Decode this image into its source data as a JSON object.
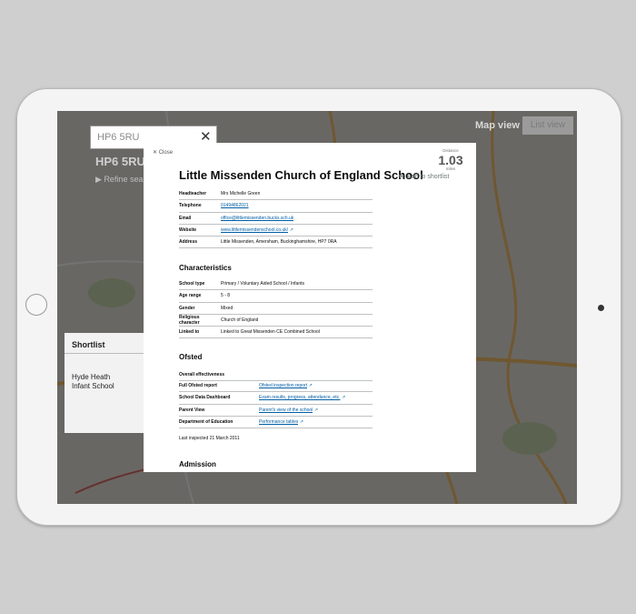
{
  "map": {
    "search_value": "HP6 5RU",
    "postcode_heading": "HP6 5RU",
    "refine_label": "Refine search",
    "map_view_label": "Map view",
    "list_view_label": "List view",
    "shortlist_title": "Shortlist",
    "shortlist_item": "Hyde Heath Infant School"
  },
  "modal": {
    "close_label": "Close",
    "distance_label": "Distance",
    "distance_value": "1.03",
    "distance_unit": "miles",
    "school_name": "Little Missenden Church of England School",
    "add_shortlist_label": "Add to shortlist",
    "contact": [
      {
        "key": "Headteacher",
        "value": "Mrs Michelle Green",
        "link": false
      },
      {
        "key": "Telephone",
        "value": "01494862021",
        "link": true
      },
      {
        "key": "Email",
        "value": "office@littlemissenden.bucks.sch.uk",
        "link": true
      },
      {
        "key": "Website",
        "value": "www.littlemissendenschool.co.uk/",
        "link": true,
        "external": true
      },
      {
        "key": "Address",
        "value": "Little Missenden, Amersham, Buckinghamshire, HP7 0RA",
        "link": false
      }
    ],
    "characteristics_title": "Characteristics",
    "characteristics": [
      {
        "key": "School type",
        "value": "Primary / Voluntary Aided School / Infants"
      },
      {
        "key": "Age range",
        "value": "5 - 8"
      },
      {
        "key": "Gender",
        "value": "Mixed"
      },
      {
        "key": "Religious character",
        "value": "Church of England"
      },
      {
        "key": "Linked to",
        "value": "Linked to Great Missenden CE Combined School"
      }
    ],
    "ofsted_title": "Ofsted",
    "overall_effectiveness": "Overall effectiveness",
    "ofsted": [
      {
        "key": "Full Ofsted report",
        "value": "Ofsted inspection report"
      },
      {
        "key": "School Data Dashboard",
        "value": "Exam results, progress, attendance, etc."
      },
      {
        "key": "Parent View",
        "value": "Parent's view of the school"
      },
      {
        "key": "Department of Education",
        "value": "Performance tables"
      }
    ],
    "last_inspected": "Last inspected 21 March 2011",
    "admission_title": "Admission"
  }
}
